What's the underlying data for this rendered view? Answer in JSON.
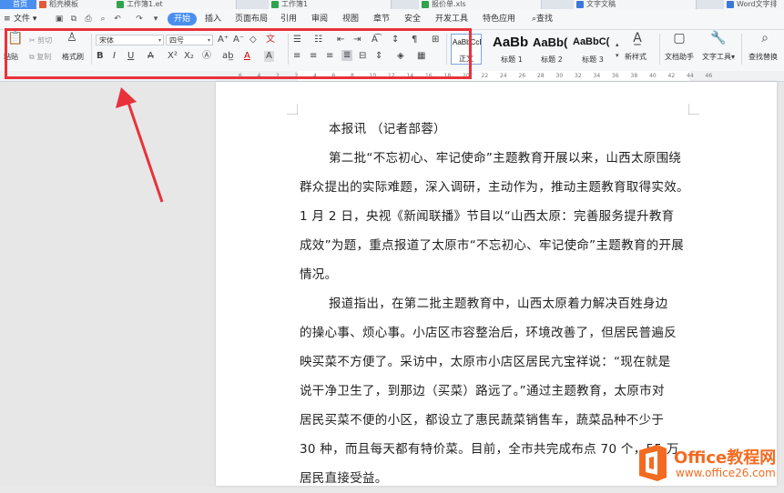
{
  "tabs": [
    {
      "label": "首页",
      "icon": "home-icon",
      "active": true
    },
    {
      "label": "稻壳模板",
      "icon": "template-icon"
    },
    {
      "label": "工作簿1.et",
      "icon": "sheet-icon"
    },
    {
      "label": "工作簿1",
      "icon": "sheet-icon"
    },
    {
      "label": "报价单.xls",
      "icon": "sheet-icon"
    },
    {
      "label": "文字文稿",
      "icon": "doc-icon"
    },
    {
      "label": "Word文字排",
      "icon": "doc-icon"
    }
  ],
  "menu": {
    "file": "文件",
    "start": "开始",
    "items": [
      "插入",
      "页面布局",
      "引用",
      "审阅",
      "视图",
      "章节",
      "安全",
      "开发工具",
      "特色应用"
    ],
    "search": "查找"
  },
  "ribbon": {
    "paste": "粘贴",
    "cut": "剪切",
    "copy": "复制",
    "format_painter": "格式刷",
    "font_name": "宋体",
    "font_size": "四号",
    "styles": [
      {
        "preview": "AaBbCcDd",
        "label": "正文"
      },
      {
        "preview": "AaBb",
        "label": "标题 1"
      },
      {
        "preview": "AaBb(",
        "label": "标题 2"
      },
      {
        "preview": "AaBbC(",
        "label": "标题 3"
      }
    ],
    "new_style": "新样式",
    "doc_assistant": "文档助手",
    "text_tools": "文字工具",
    "find_replace": "查找替换"
  },
  "ruler": {
    "ticks": [
      "6",
      "4",
      "2",
      "2",
      "4",
      "6",
      "8",
      "10",
      "12",
      "14",
      "16",
      "18",
      "20",
      "22",
      "24",
      "26",
      "28",
      "30",
      "32",
      "34",
      "36",
      "38",
      "40",
      "42",
      "44",
      "46"
    ]
  },
  "document": {
    "paragraphs": [
      {
        "lines": [
          "本报讯 （记者部蓉）"
        ]
      },
      {
        "lines": [
          "第二批“不忘初心、牢记使命”主题教育开展以来，山西太原围绕",
          "群众提出的实际难题，深入调研，主动作为，推动主题教育取得实效。",
          "1 月 2 日，央视《新闻联播》节目以“山西太原：完善服务提升教育",
          "成效”为题，重点报道了太原市“不忘初心、牢记使命”主题教育的开展",
          "情况。"
        ]
      },
      {
        "lines": [
          "报道指出，在第二批主题教育中，山西太原着力解决百姓身边",
          "的操心事、烦心事。小店区市容整治后，环境改善了，但居民普遍反",
          "映买菜不方便了。采访中，太原市小店区居民亢宝祥说：“现在就是",
          "说干净卫生了，到那边（买菜）路远了。”通过主题教育，太原市对",
          "居民买菜不便的小区，都设立了惠民蔬菜销售车，蔬菜品种不少于",
          "30 种，而且每天都有特价菜。目前，全市共完成布点 70 个，55 万",
          "居民直接受益。"
        ]
      }
    ]
  },
  "watermark": {
    "brand": "Office教程网",
    "url": "www.office26.com"
  },
  "colors": {
    "accent": "#4a8ff0",
    "highlight": "#e8323c",
    "arrow": "#e8323c",
    "brand_orange": "#f26b21"
  }
}
